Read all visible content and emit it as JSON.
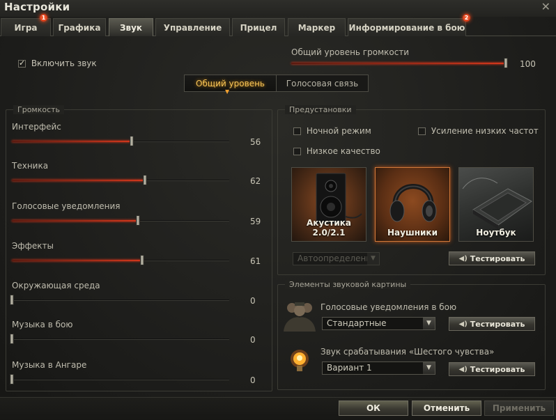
{
  "window": {
    "title": "Настройки"
  },
  "tabs": [
    {
      "label": "Игра",
      "badge": "1"
    },
    {
      "label": "Графика"
    },
    {
      "label": "Звук"
    },
    {
      "label": "Управление"
    },
    {
      "label": "Прицел"
    },
    {
      "label": "Маркер"
    },
    {
      "label": "Информирование в бою",
      "badge": "2"
    }
  ],
  "sound": {
    "enable_label": "Включить звук",
    "enable_checked": true,
    "master_label": "Общий уровень громкости",
    "master_value": "100",
    "segment": {
      "general": "Общий уровень",
      "voice": "Голосовая связь"
    }
  },
  "volume": {
    "title": "Громкость",
    "items": [
      {
        "label": "Интерфейс",
        "value": "56"
      },
      {
        "label": "Техника",
        "value": "62"
      },
      {
        "label": "Голосовые уведомления",
        "value": "59"
      },
      {
        "label": "Эффекты",
        "value": "61"
      },
      {
        "label": "Окружающая среда",
        "value": "0"
      },
      {
        "label": "Музыка в бою",
        "value": "0"
      },
      {
        "label": "Музыка в Ангаре",
        "value": "0"
      }
    ]
  },
  "presets": {
    "title": "Предустановки",
    "night_mode": "Ночной режим",
    "bass_boost": "Усиление низких частот",
    "low_quality": "Низкое качество",
    "cards": [
      {
        "label": "Акустика 2.0/2.1"
      },
      {
        "label": "Наушники"
      },
      {
        "label": "Ноутбук"
      }
    ],
    "autodetect": "Автоопределение",
    "test_label": "Тестировать"
  },
  "elements": {
    "title": "Элементы звуковой картины",
    "voice_label": "Голосовые уведомления в бою",
    "voice_value": "Стандартные",
    "sixth_label": "Звук срабатывания «Шестого чувства»",
    "sixth_value": "Вариант 1",
    "test_label": "Тестировать"
  },
  "footer": {
    "ok": "ОК",
    "cancel": "Отменить",
    "apply": "Применить"
  }
}
